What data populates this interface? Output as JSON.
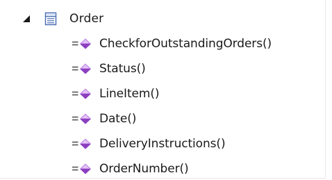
{
  "tree": {
    "class_node": {
      "label": "Order",
      "expanded": true,
      "icon": "class-icon",
      "toggle_icon": "expanded-triangle-icon"
    },
    "operations": [
      {
        "label": "CheckforOutstandingOrders()",
        "icon": "operation-icon"
      },
      {
        "label": "Status()",
        "icon": "operation-icon"
      },
      {
        "label": "LineItem()",
        "icon": "operation-icon"
      },
      {
        "label": "Date()",
        "icon": "operation-icon"
      },
      {
        "label": "DeliveryInstructions()",
        "icon": "operation-icon"
      },
      {
        "label": "OrderNumber()",
        "icon": "operation-icon"
      }
    ]
  },
  "colors": {
    "operation_gem": "#8b3fbf",
    "operation_gem_light": "#c58ee8",
    "class_icon_blue": "#4b6fb3"
  }
}
